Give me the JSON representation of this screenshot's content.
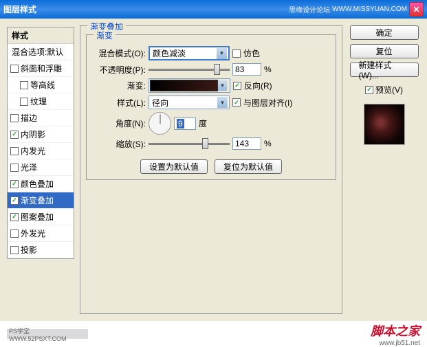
{
  "window": {
    "title": "图层样式",
    "badge1": "思缘设计论坛",
    "badge2": "WWW.MISSYUAN.COM"
  },
  "styles": {
    "header": "样式",
    "sub": "混合选项:默认",
    "items": [
      {
        "label": "斜面和浮雕",
        "checked": false,
        "indent": false
      },
      {
        "label": "等高线",
        "checked": false,
        "indent": true
      },
      {
        "label": "纹理",
        "checked": false,
        "indent": true
      },
      {
        "label": "描边",
        "checked": false,
        "indent": false
      },
      {
        "label": "内阴影",
        "checked": true,
        "indent": false
      },
      {
        "label": "内发光",
        "checked": false,
        "indent": false
      },
      {
        "label": "光泽",
        "checked": false,
        "indent": false
      },
      {
        "label": "颜色叠加",
        "checked": true,
        "indent": false
      },
      {
        "label": "渐变叠加",
        "checked": true,
        "indent": false,
        "selected": true
      },
      {
        "label": "图案叠加",
        "checked": true,
        "indent": false
      },
      {
        "label": "外发光",
        "checked": false,
        "indent": false
      },
      {
        "label": "投影",
        "checked": false,
        "indent": false
      }
    ]
  },
  "panel": {
    "title": "渐变叠加",
    "inner_title": "渐变",
    "blend_label": "混合模式(O):",
    "blend_value": "颜色减淡",
    "dither_label": "仿色",
    "opacity_label": "不透明度(P):",
    "opacity_value": "83",
    "pct": "%",
    "gradient_label": "渐变:",
    "reverse_label": "反向(R)",
    "style_label": "样式(L):",
    "style_value": "径向",
    "align_label": "与图层对齐(I)",
    "angle_label": "角度(N):",
    "angle_value": "9",
    "angle_unit": "度",
    "scale_label": "缩放(S):",
    "scale_value": "143",
    "btn_default": "设置为默认值",
    "btn_reset": "复位为默认值"
  },
  "right": {
    "ok": "确定",
    "cancel": "复位",
    "new_style": "新建样式(W)...",
    "preview": "预览(V)"
  },
  "footer": {
    "left": "PS学堂  WWW.52PSXT.COM",
    "brand": "脚本之家",
    "url": "www.jb51.net"
  }
}
